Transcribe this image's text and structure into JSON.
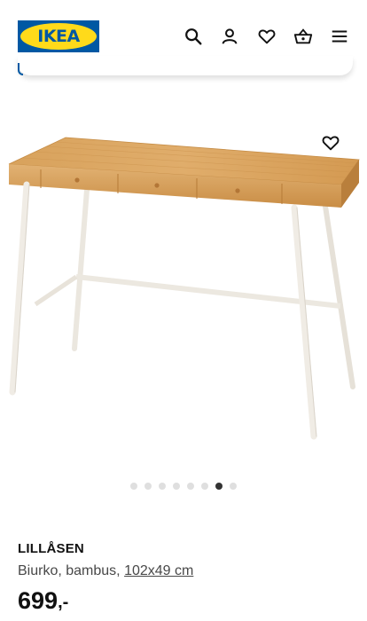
{
  "header": {
    "logo_text": "IKEA",
    "icons": [
      "search-icon",
      "user-icon",
      "heart-icon",
      "basket-icon",
      "menu-icon"
    ]
  },
  "gallery": {
    "total_images": 8,
    "active_index": 6
  },
  "product": {
    "name": "LILLÅSEN",
    "description": "Biurko, bambus, ",
    "dimensions": "102x49 cm",
    "price_integer": "699",
    "price_suffix": ",-"
  },
  "colors": {
    "brand_blue": "#0058a3",
    "brand_yellow": "#ffda1a",
    "desk_wood": "#d9a15a",
    "desk_legs": "#ece8e0"
  }
}
